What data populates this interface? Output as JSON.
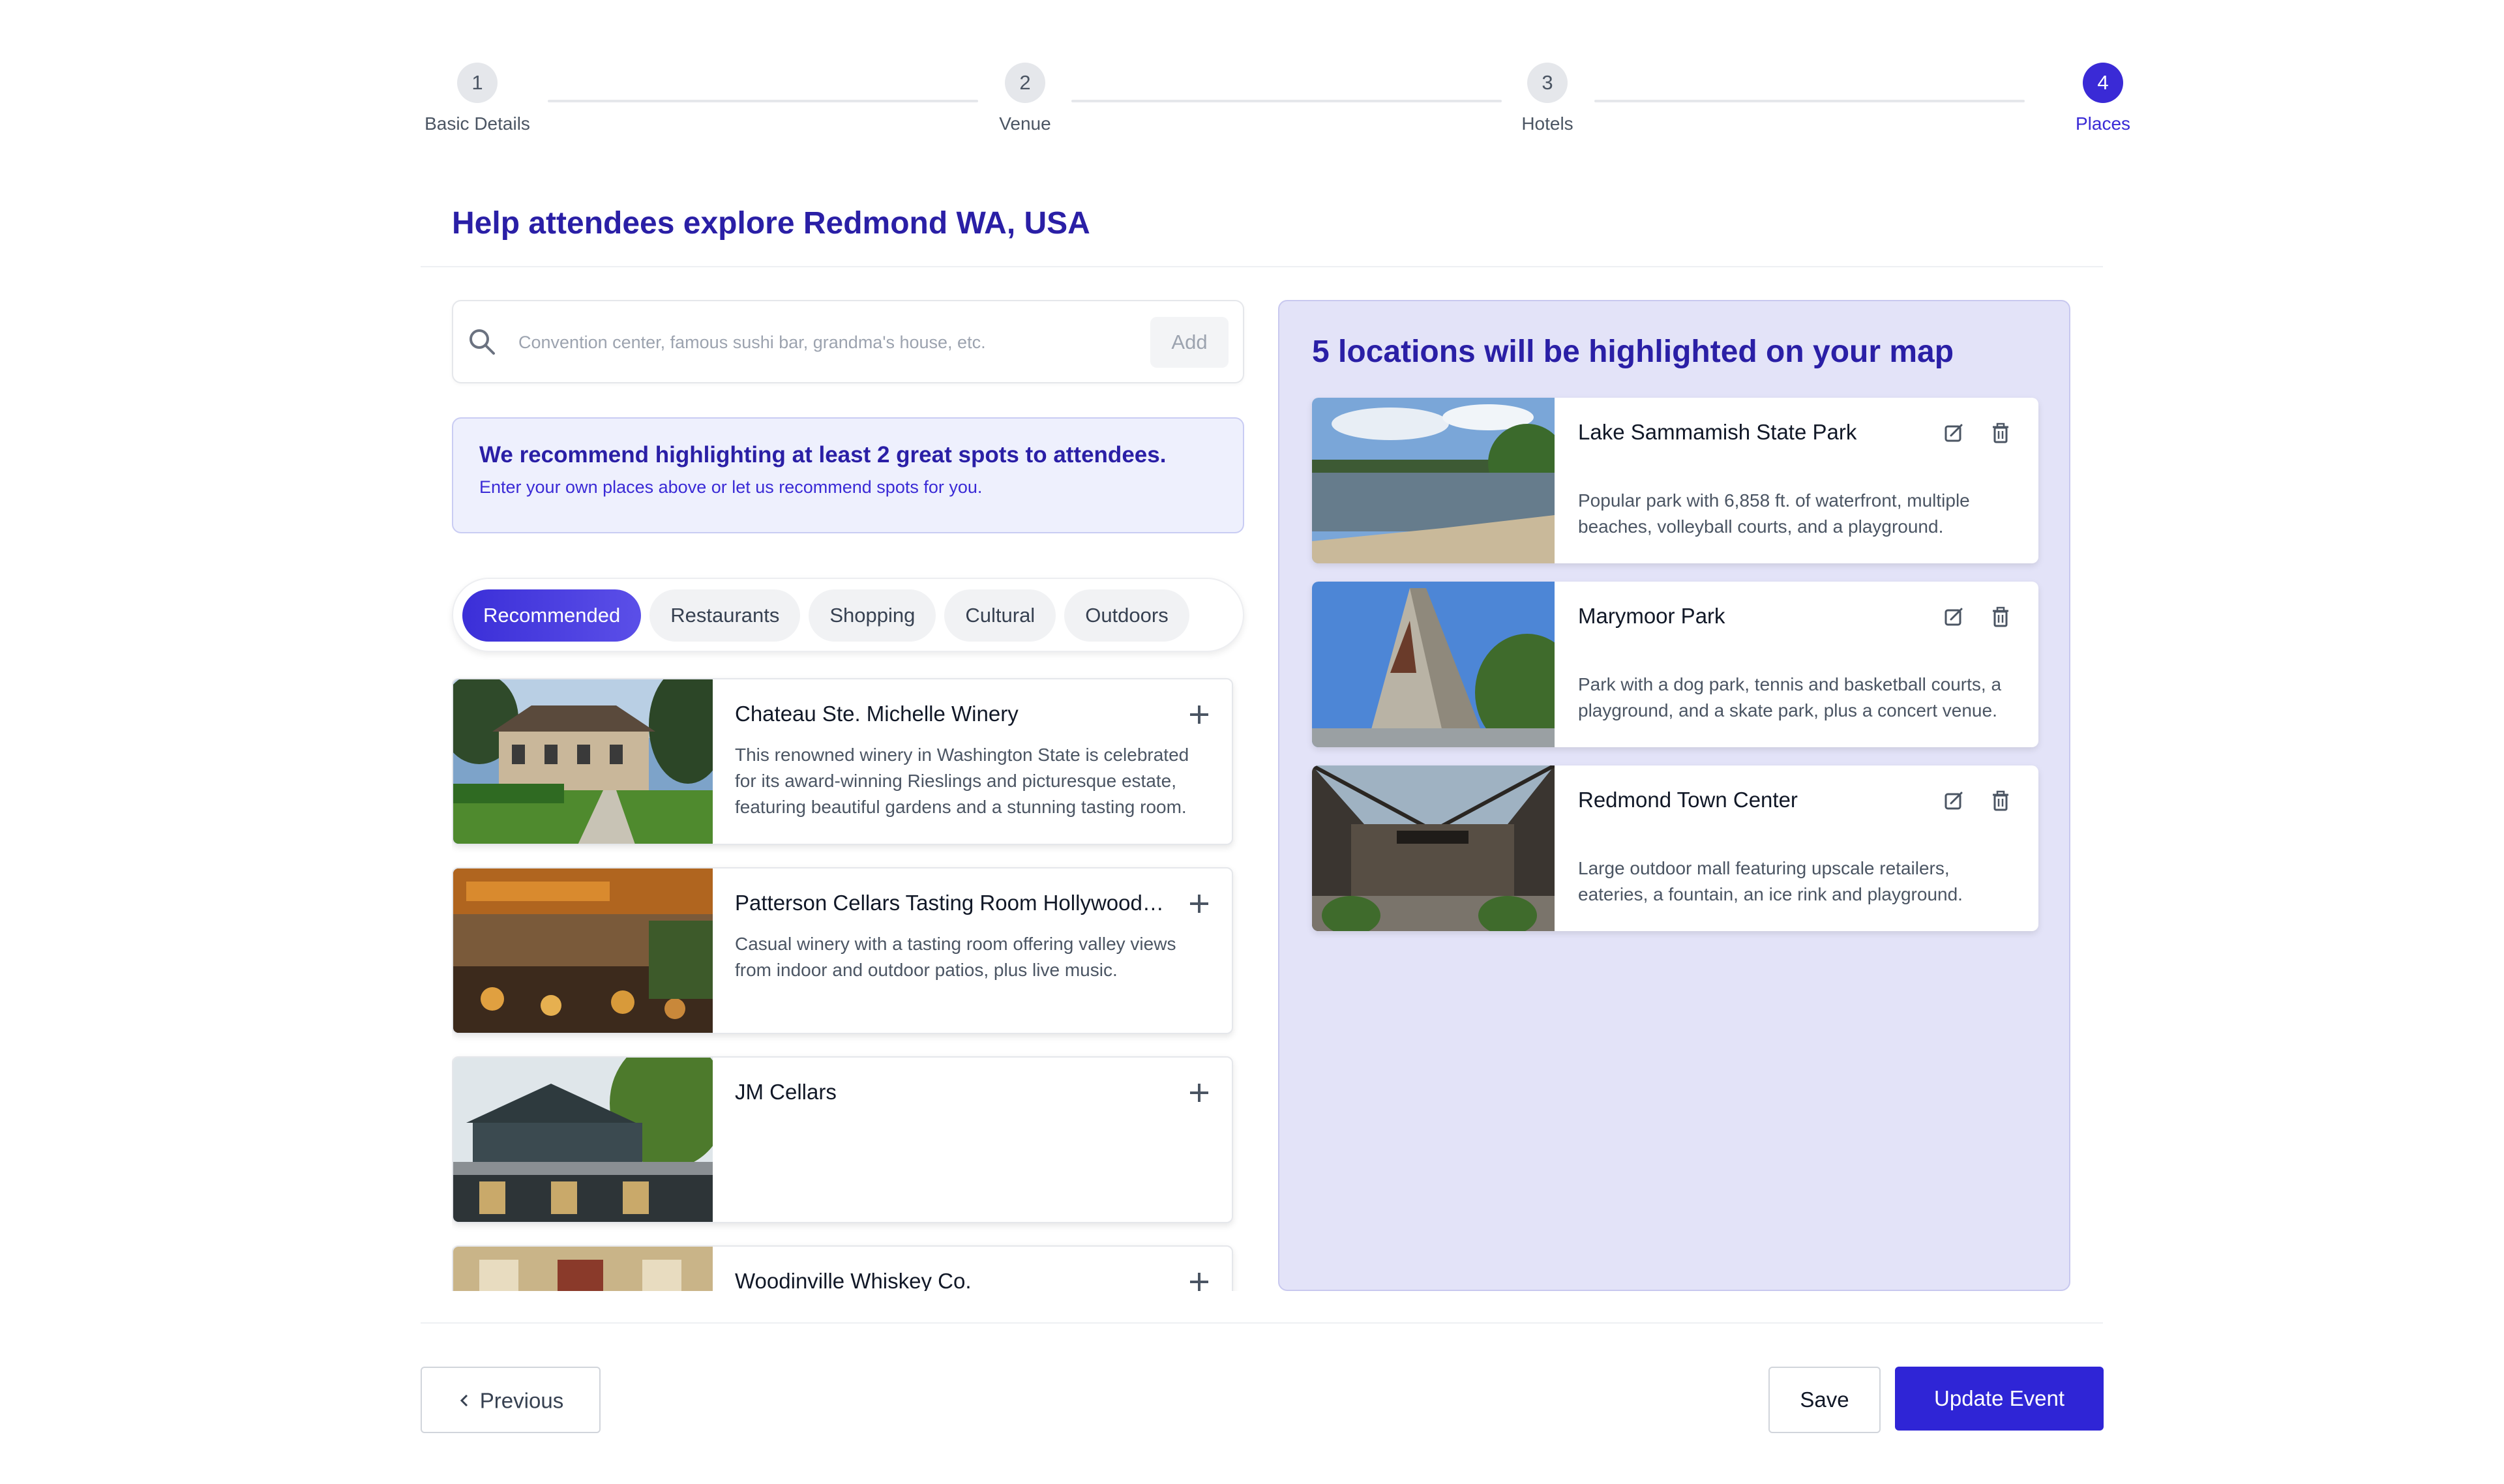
{
  "stepper": {
    "steps": [
      {
        "number": "1",
        "label": "Basic Details"
      },
      {
        "number": "2",
        "label": "Venue"
      },
      {
        "number": "3",
        "label": "Hotels"
      },
      {
        "number": "4",
        "label": "Places"
      }
    ],
    "active_step": 4
  },
  "header": {
    "title": "Help attendees explore Redmond WA, USA"
  },
  "search": {
    "placeholder": "Convention center, famous sushi bar, grandma's house, etc.",
    "value": "",
    "add_label": "Add"
  },
  "recommendation": {
    "title": "We recommend highlighting at least 2 great spots to attendees.",
    "subtitle": "Enter your own places above or let us recommend spots for you."
  },
  "tabs": [
    {
      "label": "Recommended",
      "active": true
    },
    {
      "label": "Restaurants",
      "active": false
    },
    {
      "label": "Shopping",
      "active": false
    },
    {
      "label": "Cultural",
      "active": false
    },
    {
      "label": "Outdoors",
      "active": false
    }
  ],
  "suggestions": [
    {
      "title": "Chateau Ste. Michelle Winery",
      "description": "This renowned winery in Washington State is celebrated for its award-winning Rieslings and picturesque estate, featuring beautiful gardens and a stunning tasting room."
    },
    {
      "title": "Patterson Cellars Tasting Room Hollywood Hill",
      "description": "Casual winery with a tasting room offering valley views from indoor and outdoor patios, plus live music."
    },
    {
      "title": "JM Cellars",
      "description": ""
    },
    {
      "title": "Woodinville Whiskey Co.",
      "description": ""
    }
  ],
  "highlighted": {
    "title": "5 locations will be highlighted on your map",
    "locations": [
      {
        "title": "Lake Sammamish State Park",
        "description": "Popular park with 6,858 ft. of waterfront, multiple beaches, volleyball courts, and a playground."
      },
      {
        "title": "Marymoor Park",
        "description": "Park with a dog park, tennis and basketball courts, a playground, and a skate park, plus a concert venue."
      },
      {
        "title": "Redmond Town Center",
        "description": "Large outdoor mall featuring upscale retailers, eateries, a fountain, an ice rink and playground."
      }
    ]
  },
  "footer": {
    "previous_label": "Previous",
    "save_label": "Save",
    "update_label": "Update Event"
  },
  "colors": {
    "primary": "#3a2ad6",
    "title": "#2a1fa6",
    "panel_bg": "#e3e3f8",
    "banner_bg": "#eef0fd"
  },
  "icons": [
    "search-icon",
    "plus-icon",
    "edit-icon",
    "trash-icon",
    "chevron-left-icon"
  ]
}
